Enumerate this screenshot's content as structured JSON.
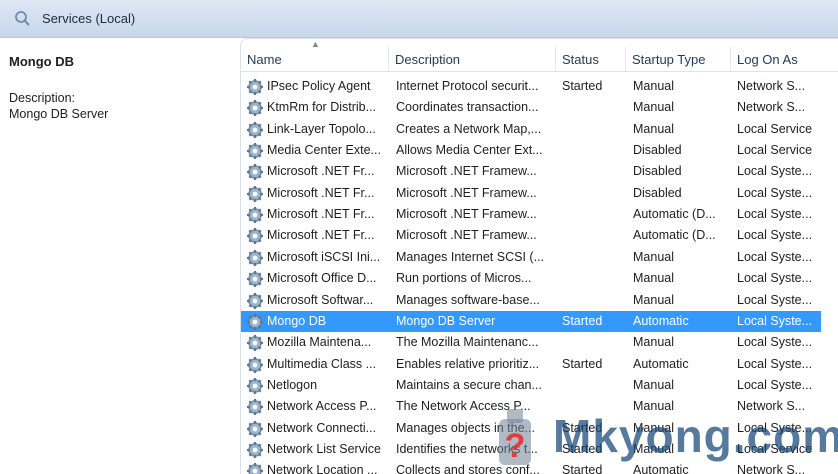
{
  "window": {
    "title": "Services (Local)",
    "icon": "search-icon"
  },
  "detail": {
    "service_name": "Mongo DB",
    "description_label": "Description:",
    "description_value": "Mongo DB Server"
  },
  "columns": [
    "Name",
    "Description",
    "Status",
    "Startup Type",
    "Log On As"
  ],
  "sorted_column": "Name",
  "colors": {
    "selection": "#3399ff",
    "header_text": "#1e395b"
  },
  "rows": [
    {
      "name": "IPsec Policy Agent",
      "description": "Internet Protocol securit...",
      "status": "Started",
      "startup": "Manual",
      "logon": "Network S..."
    },
    {
      "name": "KtmRm for Distrib...",
      "description": "Coordinates transaction...",
      "status": "",
      "startup": "Manual",
      "logon": "Network S..."
    },
    {
      "name": "Link-Layer Topolo...",
      "description": "Creates a Network Map,...",
      "status": "",
      "startup": "Manual",
      "logon": "Local Service"
    },
    {
      "name": "Media Center Exte...",
      "description": "Allows Media Center Ext...",
      "status": "",
      "startup": "Disabled",
      "logon": "Local Service"
    },
    {
      "name": "Microsoft .NET Fr...",
      "description": "Microsoft .NET Framew...",
      "status": "",
      "startup": "Disabled",
      "logon": "Local Syste..."
    },
    {
      "name": "Microsoft .NET Fr...",
      "description": "Microsoft .NET Framew...",
      "status": "",
      "startup": "Disabled",
      "logon": "Local Syste..."
    },
    {
      "name": "Microsoft .NET Fr...",
      "description": "Microsoft .NET Framew...",
      "status": "",
      "startup": "Automatic (D...",
      "logon": "Local Syste..."
    },
    {
      "name": "Microsoft .NET Fr...",
      "description": "Microsoft .NET Framew...",
      "status": "",
      "startup": "Automatic (D...",
      "logon": "Local Syste..."
    },
    {
      "name": "Microsoft iSCSI Ini...",
      "description": "Manages Internet SCSI (...",
      "status": "",
      "startup": "Manual",
      "logon": "Local Syste..."
    },
    {
      "name": "Microsoft Office D...",
      "description": "Run portions of Micros...",
      "status": "",
      "startup": "Manual",
      "logon": "Local Syste..."
    },
    {
      "name": "Microsoft Softwar...",
      "description": "Manages software-base...",
      "status": "",
      "startup": "Manual",
      "logon": "Local Syste..."
    },
    {
      "name": "Mongo DB",
      "description": "Mongo DB Server",
      "status": "Started",
      "startup": "Automatic",
      "logon": "Local Syste...",
      "selected": true
    },
    {
      "name": "Mozilla Maintena...",
      "description": "The Mozilla Maintenanc...",
      "status": "",
      "startup": "Manual",
      "logon": "Local Syste..."
    },
    {
      "name": "Multimedia Class ...",
      "description": "Enables relative prioritiz...",
      "status": "Started",
      "startup": "Automatic",
      "logon": "Local Syste..."
    },
    {
      "name": "Netlogon",
      "description": "Maintains a secure chan...",
      "status": "",
      "startup": "Manual",
      "logon": "Local Syste..."
    },
    {
      "name": "Network Access P...",
      "description": "The Network Access P...",
      "status": "",
      "startup": "Manual",
      "logon": "Network S..."
    },
    {
      "name": "Network Connecti...",
      "description": "Manages objects in the...",
      "status": "Started",
      "startup": "Manual",
      "logon": "Local Syste..."
    },
    {
      "name": "Network List Service",
      "description": "Identifies the networks t...",
      "status": "Started",
      "startup": "Manual",
      "logon": "Local Service"
    },
    {
      "name": "Network Location ...",
      "description": "Collects and stores conf...",
      "status": "Started",
      "startup": "Automatic",
      "logon": "Network S..."
    }
  ],
  "watermark": {
    "text": "Mkyong.com",
    "logo_icon": "question-mark-logo-icon"
  }
}
